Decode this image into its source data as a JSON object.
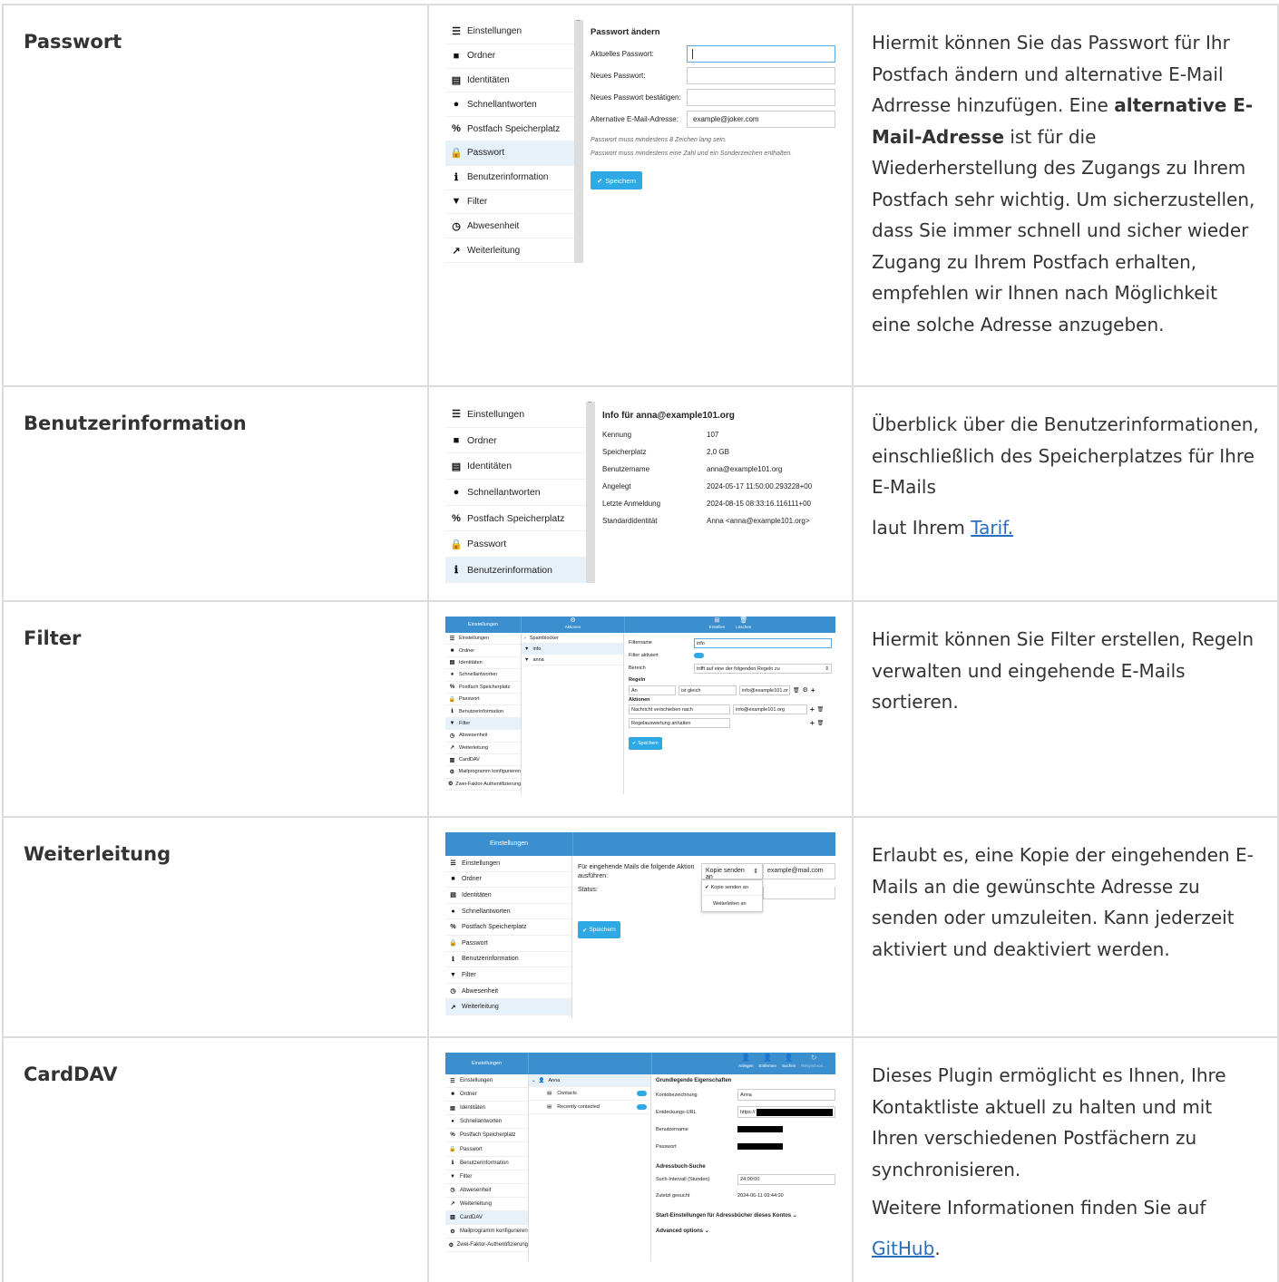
{
  "sidebar": [
    "Einstellungen",
    "Ordner",
    "Identitäten",
    "Schnellantworten",
    "Postfach Speicherplatz",
    "Passwort",
    "Benutzerinformation",
    "Filter",
    "Abwesenheit",
    "Weiterleitung",
    "CardDAV",
    "Mailprogramm konfigurieren",
    "Zwei-Faktor-Authentifizierung"
  ],
  "sidebar_icons": [
    "sliders-icon",
    "folder-icon",
    "id-card-icon",
    "speech-bubble-icon",
    "percent-icon",
    "lock-icon",
    "info-icon",
    "filter-icon",
    "clock-icon",
    "share-icon",
    "address-book-icon",
    "gear-icon",
    "gear-icon"
  ],
  "rows": [
    {
      "feature": "Passwort",
      "desc_parts": [
        "Hiermit können Sie das Passwort für Ihr Postfach ändern und alternative E-Mail Adrresse hinzufügen. Eine ",
        "alternative E-Mail-Adresse",
        " ist für die Wiederherstellung des Zugangs zu Ihrem Postfach sehr wichtig. Um sicherzustellen, dass Sie immer schnell und sicher wieder Zugang zu Ihrem Postfach erhalten, empfehlen wir Ihnen nach Möglichkeit eine solche Adresse anzugeben."
      ]
    },
    {
      "feature": "Benutzerinformation",
      "desc": "Überblick über die Benutzerinformationen, einschließlich des Speicherplatzes für Ihre E-Mails",
      "desc2": "laut Ihrem ",
      "link": "Tarif."
    },
    {
      "feature": "Filter",
      "desc": "Hiermit können Sie Filter erstellen, Regeln verwalten und eingehende E-Mails sortieren."
    },
    {
      "feature": "Weiterleitung",
      "desc": "Erlaubt es, eine Kopie der eingehenden E-Mails an die gewünschte Adresse zu senden oder umzuleiten. Kann jederzeit aktiviert und deaktiviert werden."
    },
    {
      "feature": "CardDAV",
      "desc": "Dieses Plugin ermöglicht es Ihnen, Ihre Kontaktliste aktuell zu halten und mit Ihren verschiedenen Postfächern zu synchronisieren.",
      "desc2": "Weitere Informationen finden Sie auf",
      "link": "GitHub",
      "after": "."
    }
  ],
  "passwort": {
    "title": "Passwort ändern",
    "labels": [
      "Aktuelles Passwort:",
      "Neues Passwort:",
      "Neues Passwort bestätigen:",
      "Alternative E-Mail-Adresse:"
    ],
    "alt_email": "example@joker.com",
    "hint1": "Passwort muss mindestens 8 Zeichen lang sein.",
    "hint2": "Passwort muss mindestens eine Zahl und ein Sonderzeichen enthalten.",
    "save": "Speichern"
  },
  "info": {
    "title": "Info für anna@example101.org",
    "rows": [
      [
        "Kennung",
        "107"
      ],
      [
        "Speicherplatz",
        "2,0 GB"
      ],
      [
        "Benutzername",
        "anna@example101.org"
      ],
      [
        "Angelegt",
        "2024-05-17 11:50:00.293228+00"
      ],
      [
        "Letzte Anmeldung",
        "2024-08-15 08:33:16.116111+00"
      ],
      [
        "Standardidentität",
        "Anna <anna@example101.org>"
      ]
    ]
  },
  "filter": {
    "header": "Einstellungen",
    "actions": "Aktionen",
    "create": "Erstellen",
    "delete": "Löschen",
    "list": [
      "Spamblocker",
      "info",
      "anna"
    ],
    "filtername_label": "Filtername",
    "filtername": "info",
    "active_label": "Filter aktiviert",
    "scope_label": "Bereich",
    "scope": "trifft auf eine der folgenden Regeln zu",
    "rules_label": "Regeln",
    "rule_field": "An",
    "rule_op": "ist gleich",
    "rule_value": "info@example101.or",
    "actions_label": "Aktionen",
    "action1": "Nachricht verschieben nach",
    "action1_target": "info@example101.org",
    "action2": "Regelauswertung anhalten",
    "save": "Speichern"
  },
  "forward": {
    "header": "Einstellungen",
    "action_label": "Für eingehende Mails die folgende Aktion ausführen:",
    "select": "Kopie senden an",
    "email": "example@mail.com",
    "status_label": "Status:",
    "options": [
      "Kopie senden an",
      "Weiterleiten an"
    ],
    "save": "Speichern"
  },
  "carddav": {
    "header": "Einstellungen",
    "tools": [
      "Anlegen",
      "Entfernen",
      "Suchen",
      "Resynchron..."
    ],
    "account": "Anna",
    "books": [
      "Contacts",
      "Recently contacted"
    ],
    "section1": "Grundlegende Eigenschaften",
    "fields": [
      [
        "Kontobezeichnung",
        "Anna"
      ],
      [
        "Entdeckungs-URL",
        "https://"
      ],
      [
        "Benutzername",
        ""
      ],
      [
        "Passwort",
        ""
      ]
    ],
    "section2": "Adressbuch-Suche",
    "interval_label": "Such-Intervall (Stunden)",
    "interval": "24:00:00",
    "last_label": "Zuletzt gesucht",
    "last": "2024-06-11 09:44:00",
    "section3": "Start-Einstellungen für Adressbücher dieses Kontos",
    "section4": "Advanced options"
  }
}
